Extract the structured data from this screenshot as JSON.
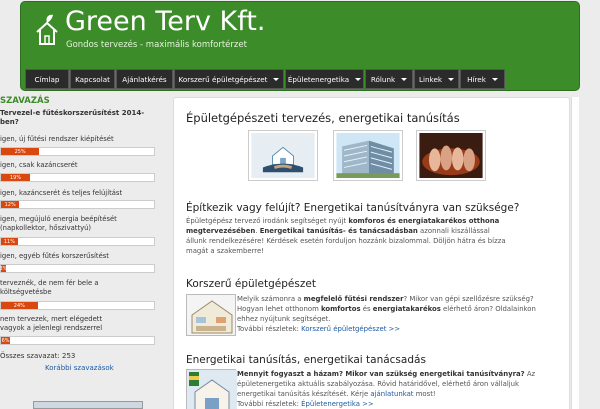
{
  "brand": {
    "title": "Green Terv Kft.",
    "subtitle": "Gondos tervezés - maximális komfortérzet",
    "color": "#3d8c2a"
  },
  "nav": [
    {
      "label": "Címlap",
      "dropdown": false
    },
    {
      "label": "Kapcsolat",
      "dropdown": false
    },
    {
      "label": "Ajánlatkérés",
      "dropdown": false
    },
    {
      "label": "Korszerű épületgépészet",
      "dropdown": true
    },
    {
      "label": "Épületenergetika",
      "dropdown": true
    },
    {
      "label": "Rólunk",
      "dropdown": true
    },
    {
      "label": "Linkek",
      "dropdown": true
    },
    {
      "label": "Hírek",
      "dropdown": true
    }
  ],
  "poll": {
    "title": "SZAVAZÁS",
    "question": "Tervezel-e fűtéskorszerűsítést 2014-ben?",
    "options": [
      {
        "label": "igen, új fűtési rendszer kiépítését",
        "percent": 25,
        "percent_label": "25%"
      },
      {
        "label": "igen, csak kazáncserét",
        "percent": 19,
        "percent_label": "19%"
      },
      {
        "label": "igen, kazáncserét és teljes felújítást",
        "percent": 12,
        "percent_label": "12%"
      },
      {
        "label": "igen, megújuló energia beépítését (napkollektor, hőszivattyú)",
        "percent": 11,
        "percent_label": "11%"
      },
      {
        "label": "igen, egyéb fűtés korszerűsítést",
        "percent": 3,
        "percent_label": "3%"
      },
      {
        "label": "terveznék, de nem fér bele a költségvetésbe",
        "percent": 24,
        "percent_label": "24%"
      },
      {
        "label": "nem tervezek, mert elégedett vagyok a jelenlegi rendszerrel",
        "percent": 6,
        "percent_label": "6%"
      }
    ],
    "total": "Összes szavazat: 253",
    "prev_link": "Korábbi szavazások",
    "bar_color": "#d9480f"
  },
  "main": {
    "heading": "Épületgépészeti tervezés, energetikai tanúsítás",
    "section1": {
      "title": "Építkezik vagy felújít? Energetikai tanúsítványra van szüksége?",
      "t1": "Épületgépész tervező irodánk segítséget nyújt ",
      "l1": "komforos és energiatakarékos otthona megtervezésében",
      "t2": ". ",
      "l2": "Energetikai tanúsítás- és tanácsadásban",
      "t3": " azonnali kiszállással állunk rendelkezésére! Kérdések esetén forduljon hozzánk bizalommal. Döljön hátra és bízza magát a szakemberre!"
    },
    "section2": {
      "title": "Korszerű épületgépészet",
      "t1": "Melyik számonra a ",
      "b1": "megfelelő fűtési rendszer",
      "t2": "? Mikor van gépi szellőzésre szükség? Hogyan lehet otthonom ",
      "b2": "komfortos",
      "t3": " és ",
      "b3": "energiatakarékos",
      "t4": " elérhető áron? Oldalainkon ehhez nyújtunk segítséget.",
      "more_label": "További részletek: ",
      "more_link": "Korszerű épületgépészet >>"
    },
    "section3": {
      "title": "Energetikai tanúsítás, energetikai tanácsadás",
      "b1": "Mennyit fogyaszt a házam? Mikor van szükség energetikai tanúsítványra?",
      "t1": " Az épületenergetika aktuális szabályozása. Rövid határidővel, elérhető áron vállaljuk energetikai tanúsítás készítését. Kérje ",
      "l1": "ajánlatunkat",
      "t2": " most!",
      "more_label": "További részletek: ",
      "more_link": "Épületenergetika >>"
    }
  }
}
